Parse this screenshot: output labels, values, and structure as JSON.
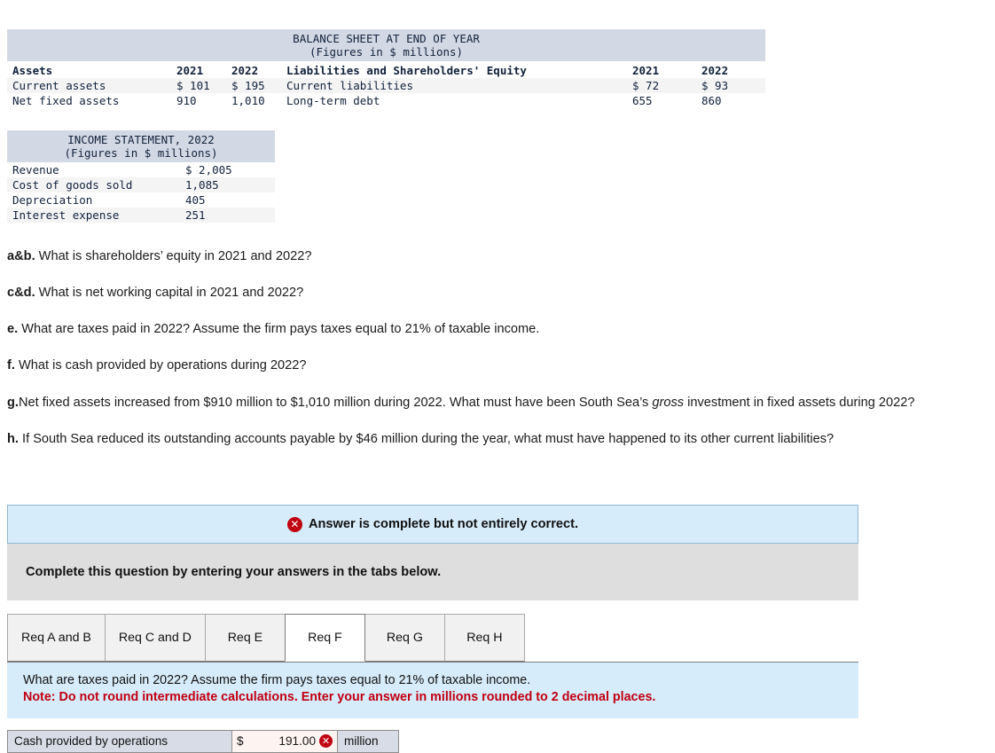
{
  "balance_sheet": {
    "title": "BALANCE SHEET AT END OF YEAR",
    "subtitle": "(Figures in $ millions)",
    "headers": {
      "assets": "Assets",
      "assets_2021": "2021",
      "assets_2022": "2022",
      "liabilities": "Liabilities and Shareholders' Equity",
      "liab_2021": "2021",
      "liab_2022": "2022"
    },
    "rows": [
      {
        "asset_label": "Current assets",
        "asset_2021": "$ 101",
        "asset_2022": "$ 195",
        "liab_label": "Current liabilities",
        "liab_2021": "$ 72",
        "liab_2022": "$ 93"
      },
      {
        "asset_label": "Net fixed assets",
        "asset_2021": "910",
        "asset_2022": "1,010",
        "liab_label": "Long-term debt",
        "liab_2021": "655",
        "liab_2022": "860"
      }
    ]
  },
  "income_statement": {
    "title": "INCOME STATEMENT, 2022",
    "subtitle": "(Figures in $ millions)",
    "rows": [
      {
        "label": "Revenue",
        "value": "$ 2,005"
      },
      {
        "label": "Cost of goods sold",
        "value": "1,085"
      },
      {
        "label": "Depreciation",
        "value": "405"
      },
      {
        "label": "Interest expense",
        "value": "251"
      }
    ]
  },
  "questions": [
    {
      "marker": "a&b.",
      "text": " What is shareholders’ equity in 2021 and 2022?",
      "italic": "",
      "tail": ""
    },
    {
      "marker": "c&d.",
      "text": " What is net working capital in 2021 and 2022?",
      "italic": "",
      "tail": ""
    },
    {
      "marker": "e.",
      "text": " What are taxes paid in 2022? Assume the firm pays taxes equal to 21% of taxable income.",
      "italic": "",
      "tail": ""
    },
    {
      "marker": "f.",
      "text": " What is cash provided by operations during 2022?",
      "italic": "",
      "tail": ""
    },
    {
      "marker": "g.",
      "text": "Net fixed assets increased from $910 million to $1,010 million during 2022. What must have been South Sea’s ",
      "italic": "gross",
      "tail": " investment in fixed assets during 2022?"
    },
    {
      "marker": "h.",
      "text": " If South Sea reduced its outstanding accounts payable by $46 million during the year, what must have happened to its other current liabilities?",
      "italic": "",
      "tail": ""
    }
  ],
  "status": {
    "icon": "error-x-icon",
    "glyph": "✕",
    "message": "Answer is complete but not entirely correct.",
    "color": "#c00011",
    "background": "#d7ecfb"
  },
  "instructions": {
    "text": "Complete this question by entering your answers in the tabs below."
  },
  "tabs": {
    "items": [
      {
        "label": "Req A and B",
        "active": false
      },
      {
        "label": "Req C and D",
        "active": false
      },
      {
        "label": "Req E",
        "active": false
      },
      {
        "label": "Req F",
        "active": true
      },
      {
        "label": "Req G",
        "active": false
      },
      {
        "label": "Req H",
        "active": false
      }
    ]
  },
  "prompt": {
    "main": "What are taxes paid in 2022? Assume the firm pays taxes equal to 21% of taxable income.",
    "note": "Note: Do not round intermediate calculations. Enter your answer in millions rounded to 2 decimal places."
  },
  "answer": {
    "label": "Cash provided by operations",
    "currency": "$",
    "value": "191.00",
    "unit": "million",
    "status_glyph": "✕"
  }
}
